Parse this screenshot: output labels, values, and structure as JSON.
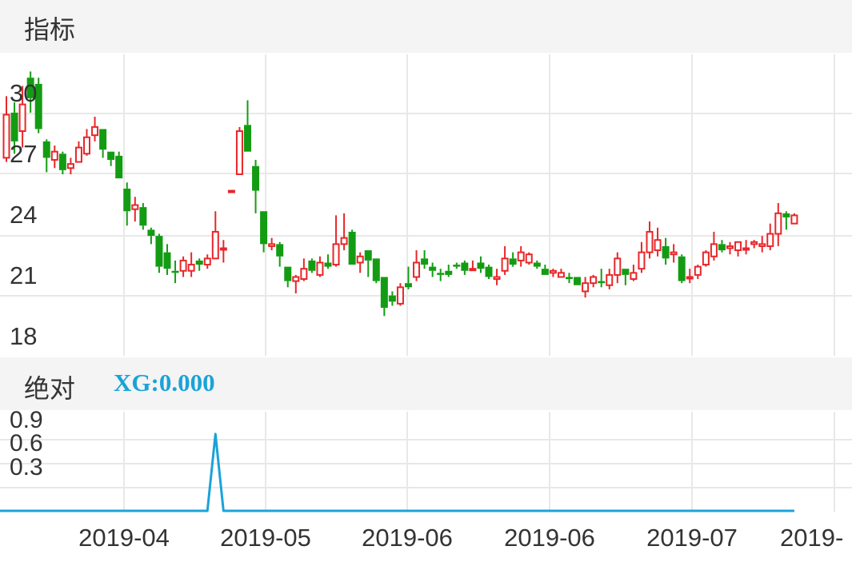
{
  "top_panel": {
    "title": "指标"
  },
  "bottom_panel": {
    "title": "绝对",
    "indicator_label": "XG:0.000"
  },
  "colors": {
    "up": "#e8262a",
    "down": "#139c13",
    "indicator_line": "#1aa3d9",
    "grid": "#e8e8e8",
    "header_bg": "#f4f4f4",
    "text": "#333333"
  },
  "chart_data": [
    {
      "type": "candlestick",
      "y_ticks": [
        "30",
        "27",
        "24",
        "21",
        "18"
      ],
      "y_tick_values": [
        30,
        27,
        24,
        21,
        18
      ],
      "ylim": [
        18,
        31
      ],
      "x_tick_labels": [
        "2019-04",
        "2019-05",
        "2019-06",
        "2019-06",
        "2019-07",
        "2019-"
      ],
      "grid": true,
      "candles": [
        [
          26.7,
          28.8,
          29.7,
          26.5
        ],
        [
          28.9,
          27.5,
          29.4,
          26.9
        ],
        [
          28.0,
          29.3,
          30.2,
          27.2
        ],
        [
          30.6,
          29.6,
          30.9,
          28.9
        ],
        [
          30.3,
          28.1,
          30.6,
          27.9
        ],
        [
          27.5,
          26.7,
          27.6,
          26.0
        ],
        [
          26.6,
          27.0,
          27.3,
          26.2
        ],
        [
          26.9,
          26.1,
          27.0,
          25.9
        ],
        [
          26.2,
          26.4,
          26.7,
          25.9
        ],
        [
          26.5,
          27.2,
          27.5,
          26.5
        ],
        [
          26.9,
          27.7,
          28.1,
          26.8
        ],
        [
          27.8,
          28.2,
          28.7,
          27.5
        ],
        [
          28.1,
          27.1,
          28.1,
          26.7
        ],
        [
          27.0,
          26.6,
          27.0,
          26.3
        ],
        [
          26.8,
          25.7,
          27.0,
          25.7
        ],
        [
          25.2,
          24.1,
          25.5,
          23.4
        ],
        [
          24.2,
          24.4,
          24.8,
          23.6
        ],
        [
          24.3,
          23.4,
          24.5,
          23.2
        ],
        [
          23.2,
          22.9,
          23.3,
          22.5
        ],
        [
          22.9,
          21.4,
          23.0,
          21.1
        ],
        [
          22.1,
          21.3,
          22.5,
          21.0
        ],
        [
          21.2,
          21.1,
          21.7,
          20.6
        ],
        [
          21.2,
          21.7,
          21.9,
          20.9
        ],
        [
          21.2,
          21.5,
          22.1,
          20.9
        ],
        [
          21.7,
          21.5,
          21.8,
          21.2
        ],
        [
          21.5,
          21.8,
          22.0,
          21.3
        ],
        [
          21.8,
          23.1,
          24.1,
          21.8
        ],
        [
          22.3,
          22.3,
          22.7,
          21.6
        ],
        [
          25.1,
          25.1,
          25.1,
          25.1
        ],
        [
          25.9,
          28.0,
          28.2,
          26.1
        ],
        [
          28.3,
          27.0,
          29.5,
          27.0
        ],
        [
          26.3,
          25.1,
          26.6,
          24.0
        ],
        [
          24.1,
          22.5,
          24.1,
          22.1
        ],
        [
          22.4,
          22.5,
          22.8,
          22.2
        ],
        [
          22.5,
          21.9,
          22.6,
          21.4
        ],
        [
          21.4,
          20.7,
          21.4,
          20.4
        ],
        [
          20.7,
          20.9,
          21.0,
          20.1
        ],
        [
          20.8,
          21.3,
          21.8,
          20.7
        ],
        [
          21.7,
          21.2,
          21.8,
          21.1
        ],
        [
          21.0,
          21.6,
          21.9,
          20.9
        ],
        [
          21.6,
          21.4,
          22.0,
          21.3
        ],
        [
          21.5,
          22.5,
          23.9,
          21.4
        ],
        [
          22.5,
          22.8,
          24.0,
          22.2
        ],
        [
          23.1,
          21.5,
          23.2,
          21.5
        ],
        [
          21.6,
          21.9,
          22.1,
          21.1
        ],
        [
          22.2,
          21.7,
          22.2,
          20.9
        ],
        [
          21.8,
          20.7,
          21.8,
          20.6
        ],
        [
          20.9,
          19.4,
          20.9,
          19.0
        ],
        [
          20.0,
          19.7,
          20.2,
          19.5
        ],
        [
          19.6,
          20.4,
          20.6,
          19.5
        ],
        [
          20.6,
          20.4,
          21.4,
          20.3
        ],
        [
          20.9,
          21.6,
          22.2,
          20.7
        ],
        [
          21.8,
          21.5,
          22.2,
          21.3
        ],
        [
          21.4,
          21.2,
          21.6,
          20.9
        ],
        [
          21.1,
          21.0,
          21.3,
          20.7
        ],
        [
          21.2,
          21.0,
          21.5,
          20.9
        ],
        [
          21.5,
          21.4,
          21.6,
          21.3
        ],
        [
          21.6,
          21.2,
          21.7,
          21.0
        ],
        [
          21.3,
          21.3,
          21.7,
          21.2
        ],
        [
          21.6,
          21.3,
          21.9,
          21.1
        ],
        [
          21.4,
          20.9,
          21.5,
          20.8
        ],
        [
          20.8,
          20.9,
          21.3,
          20.5
        ],
        [
          21.2,
          21.8,
          22.4,
          21.0
        ],
        [
          21.8,
          21.5,
          22.1,
          21.4
        ],
        [
          21.7,
          22.1,
          22.4,
          21.4
        ],
        [
          21.6,
          22.0,
          22.1,
          21.5
        ],
        [
          21.6,
          21.4,
          21.7,
          21.3
        ],
        [
          21.3,
          21.0,
          21.5,
          21.0
        ],
        [
          21.1,
          21.2,
          21.3,
          20.9
        ],
        [
          20.9,
          21.1,
          21.3,
          20.9
        ],
        [
          20.9,
          20.8,
          21.1,
          20.6
        ],
        [
          20.9,
          20.5,
          20.9,
          20.5
        ],
        [
          20.2,
          20.6,
          20.9,
          19.9
        ],
        [
          20.6,
          20.9,
          21.0,
          20.4
        ],
        [
          20.7,
          20.6,
          21.3,
          20.4
        ],
        [
          20.5,
          21.0,
          21.3,
          20.3
        ],
        [
          21.0,
          21.8,
          22.1,
          20.6
        ],
        [
          21.3,
          21.0,
          21.3,
          20.5
        ],
        [
          20.8,
          21.1,
          21.5,
          20.7
        ],
        [
          21.3,
          22.1,
          22.6,
          21.1
        ],
        [
          22.1,
          23.1,
          23.6,
          21.8
        ],
        [
          22.2,
          22.7,
          23.3,
          21.9
        ],
        [
          22.4,
          21.8,
          22.8,
          21.5
        ],
        [
          22.0,
          22.1,
          22.5,
          21.6
        ],
        [
          21.9,
          20.7,
          22.0,
          20.6
        ],
        [
          20.9,
          20.9,
          21.3,
          20.6
        ],
        [
          21.0,
          21.4,
          21.5,
          20.8
        ],
        [
          21.5,
          22.1,
          22.2,
          21.4
        ],
        [
          21.9,
          22.5,
          23.1,
          21.7
        ],
        [
          22.5,
          22.2,
          22.7,
          22.1
        ],
        [
          22.3,
          22.4,
          22.6,
          22.0
        ],
        [
          22.2,
          22.6,
          22.6,
          21.9
        ],
        [
          22.3,
          22.3,
          22.7,
          22.0
        ],
        [
          22.5,
          22.6,
          22.7,
          22.3
        ],
        [
          22.4,
          22.5,
          22.9,
          22.1
        ],
        [
          22.4,
          23.0,
          23.5,
          22.2
        ],
        [
          23.0,
          24.0,
          24.5,
          22.4
        ],
        [
          24.0,
          23.8,
          24.1,
          23.2
        ],
        [
          23.5,
          23.9,
          24.0,
          23.7
        ]
      ]
    },
    {
      "type": "line",
      "y_ticks": [
        "0.9",
        "0.6",
        "0.3"
      ],
      "y_tick_values": [
        0.9,
        0.6,
        0.3
      ],
      "ylim": [
        0,
        1.1
      ],
      "grid": true,
      "spike": {
        "at_candle": 26,
        "value": 0.73
      },
      "baseline_value": 0
    }
  ]
}
